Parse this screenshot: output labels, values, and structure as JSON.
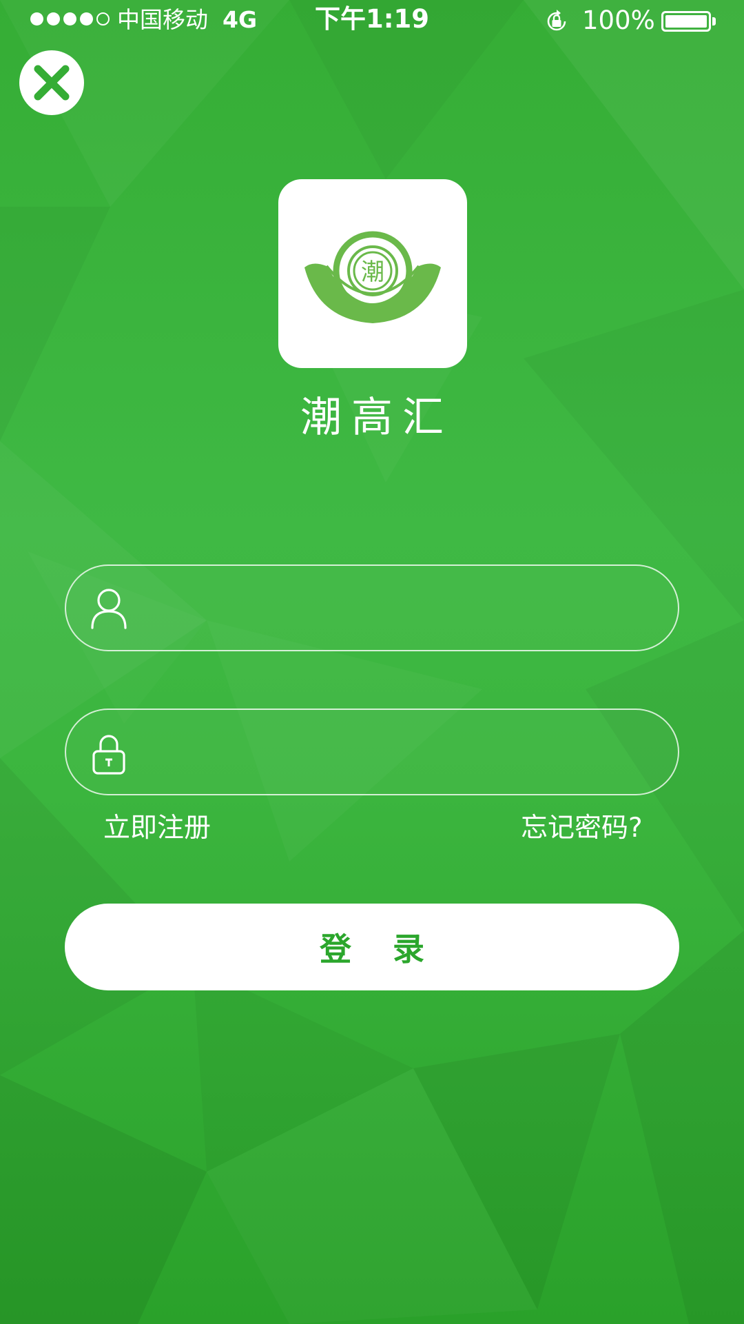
{
  "colors": {
    "brand_green": "#3cb43f",
    "button_text": "#2ba62c",
    "white": "#ffffff"
  },
  "status_bar": {
    "signal_bars": 5,
    "signal_filled": 4,
    "carrier": "中国移动",
    "network": "4G",
    "time": "下午1:19",
    "battery_percent": "100%",
    "battery_level": 1.0,
    "rotation_lock_icon": "rotation-lock-icon"
  },
  "header": {
    "close_icon": "close-icon"
  },
  "brand": {
    "logo_icon": "ingot-logo-icon",
    "logo_seal_text": "潮",
    "app_name": "潮高汇"
  },
  "login_form": {
    "username": {
      "icon": "user-icon",
      "value": "",
      "placeholder": ""
    },
    "password": {
      "icon": "lock-icon",
      "value": "",
      "placeholder": ""
    },
    "register_link": "立即注册",
    "forgot_link": "忘记密码?",
    "login_button": "登 录"
  }
}
